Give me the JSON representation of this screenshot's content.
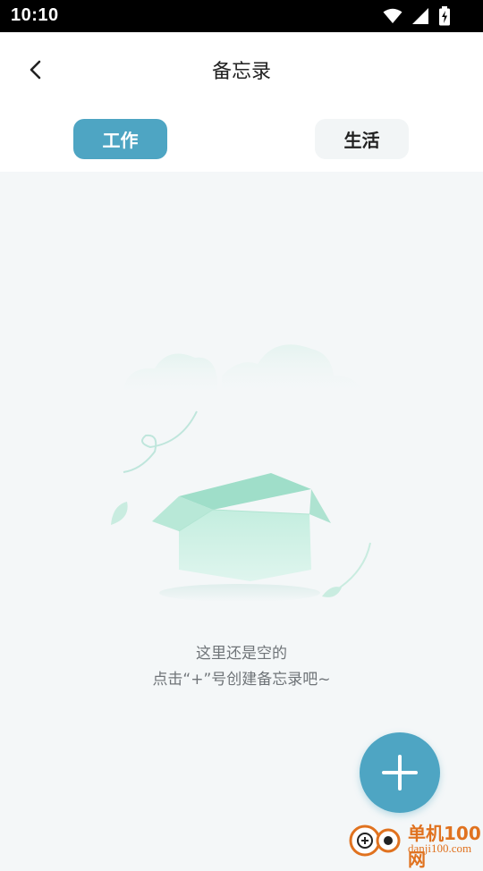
{
  "status_bar": {
    "time": "10:10",
    "icons": [
      "wifi-icon",
      "signal-icon",
      "battery-charging-icon"
    ]
  },
  "header": {
    "title": "备忘录",
    "back_icon": "chevron-left-icon"
  },
  "tabs": [
    {
      "label": "工作",
      "selected": true
    },
    {
      "label": "生活",
      "selected": false
    }
  ],
  "empty_state": {
    "line1": "这里还是空的",
    "line2": "点击“+”号创建备忘录吧~",
    "illustration": "empty-box-illustration"
  },
  "fab": {
    "icon": "plus-icon"
  },
  "watermark": {
    "title": "单机100网",
    "subtitle": "danji100.com"
  },
  "colors": {
    "accent": "#4ea5c3",
    "background": "#f4f7f8",
    "box": "#bfeadb"
  }
}
